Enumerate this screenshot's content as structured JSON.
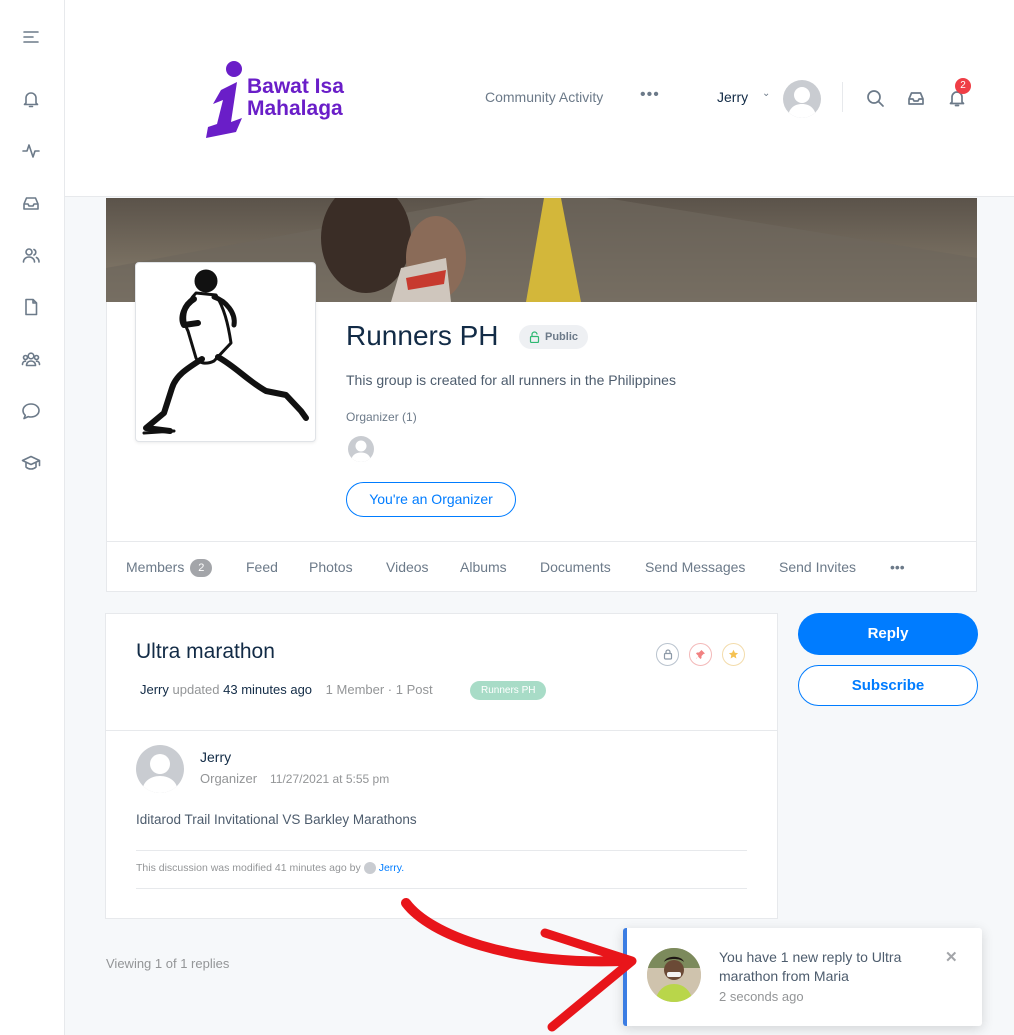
{
  "logo": {
    "line1": "Bawat Isa",
    "line2": "Mahalaga"
  },
  "header": {
    "nav_link": "Community Activity",
    "more": "•••",
    "user_name": "Jerry",
    "notification_count": "2"
  },
  "group": {
    "title": "Runners PH",
    "visibility": "Public",
    "description": "This group is created for all runners in the Philippines",
    "organizer_label": "Organizer (1)",
    "organizer_button": "You're an Organizer",
    "tabs": [
      {
        "label": "Members",
        "count": "2"
      },
      {
        "label": "Feed"
      },
      {
        "label": "Photos"
      },
      {
        "label": "Videos"
      },
      {
        "label": "Albums"
      },
      {
        "label": "Documents"
      },
      {
        "label": "Send Messages"
      },
      {
        "label": "Send Invites"
      },
      {
        "label": "•••"
      }
    ]
  },
  "discussion": {
    "title": "Ultra marathon",
    "author": "Jerry",
    "updated": "updated",
    "time_ago": "43 minutes ago",
    "stats": "1 Member · 1 Post",
    "group_tag": "Runners PH",
    "reply": {
      "author": "Jerry",
      "role": "Organizer",
      "date": "11/27/2021 at 5:55 pm",
      "body": "Iditarod Trail Invitational VS Barkley Marathons"
    },
    "modified_text": "This discussion was modified 41 minutes ago by",
    "modified_by": "Jerry."
  },
  "actions": {
    "reply": "Reply",
    "subscribe": "Subscribe"
  },
  "viewing": "Viewing 1 of 1 replies",
  "toast": {
    "message": "You have 1 new reply to Ultra marathon from Maria",
    "time": "2 seconds ago",
    "close": "✕"
  },
  "colors": {
    "accent": "#007cff",
    "brand": "#6a1ec8",
    "badge": "#ef3e46",
    "toast_border": "#3b7de3",
    "arrow": "#e8151a"
  }
}
